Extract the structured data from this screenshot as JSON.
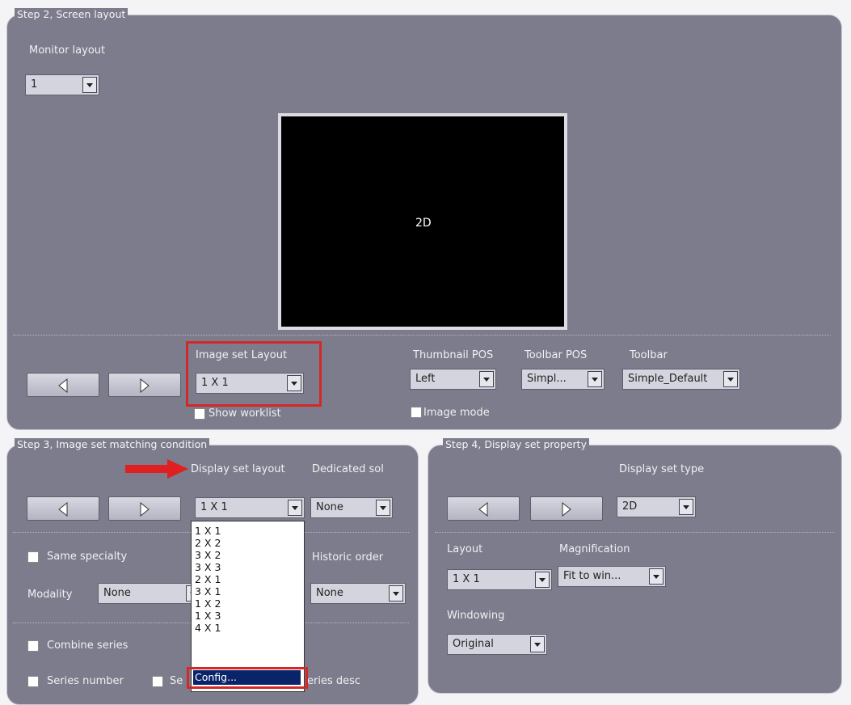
{
  "step2": {
    "legend": "Step 2, Screen layout",
    "monitor_layout_label": "Monitor layout",
    "monitor_layout_value": "1",
    "preview_text": "2D",
    "image_set_layout_label": "Image set Layout",
    "image_set_layout_value": "1 X 1",
    "show_worklist_label": "Show worklist",
    "thumbnail_pos_label": "Thumbnail POS",
    "thumbnail_pos_value": "Left",
    "toolbar_pos_label": "Toolbar POS",
    "toolbar_pos_value": "Simpl...",
    "toolbar_label": "Toolbar",
    "toolbar_value": "Simple_Default",
    "image_mode_label": "Image mode"
  },
  "step3": {
    "legend": "Step 3, Image set matching condition",
    "display_set_layout_label": "Display set layout",
    "display_set_layout_value": "1 X 1",
    "dedicated_label": "Dedicated sol",
    "dedicated_value": "None",
    "same_specialty_label": "Same specialty",
    "historic_order_label": "Historic order",
    "historic_order_value": "None",
    "modality_label": "Modality",
    "modality_value": "None",
    "combine_series_label": "Combine series",
    "series_number_label": "Series number",
    "series_partial_label": "Se",
    "series_desc_partial_label": "eries desc",
    "dropdown_options": [
      "1 X 1",
      "2 X 2",
      "3 X 2",
      "3 X 3",
      "2 X 1",
      "3 X 1",
      "1 X 2",
      "1 X 3",
      "4 X 1"
    ],
    "dropdown_selected": "Config..."
  },
  "step4": {
    "legend": "Step 4, Display set property",
    "display_set_type_label": "Display set type",
    "display_set_type_value": "2D",
    "layout_label": "Layout",
    "layout_value": "1 X 1",
    "magnification_label": "Magnification",
    "magnification_value": "Fit to win...",
    "windowing_label": "Windowing",
    "windowing_value": "Original"
  },
  "colors": {
    "panel": "#7c7c8c",
    "highlight": "#d42828",
    "selection": "#0a246a"
  }
}
